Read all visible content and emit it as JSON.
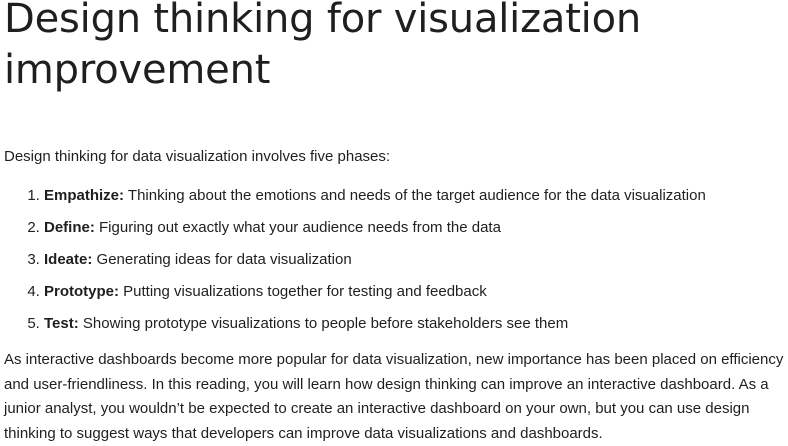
{
  "title": "Design thinking for visualization improvement",
  "intro": "Design thinking for data visualization involves five phases:",
  "phases": [
    {
      "term": "Empathize:",
      "text": "Thinking about the emotions and needs of the target audience for the data visualization"
    },
    {
      "term": "Define:",
      "text": "Figuring out exactly what your audience needs from the data"
    },
    {
      "term": "Ideate:",
      "text": "Generating ideas for data visualization"
    },
    {
      "term": "Prototype:",
      "text": "Putting visualizations together for testing and feedback"
    },
    {
      "term": "Test:",
      "text": "Showing prototype visualizations to people before stakeholders see them"
    }
  ],
  "body": "As interactive dashboards become more popular for data visualization, new importance has been placed on efficiency and user-friendliness. In this reading, you will learn how design thinking can improve an interactive dashboard. As a junior analyst, you wouldn’t be expected to create an interactive dashboard on your own, but you can use design thinking to suggest ways that developers can improve data visualizations and dashboards."
}
